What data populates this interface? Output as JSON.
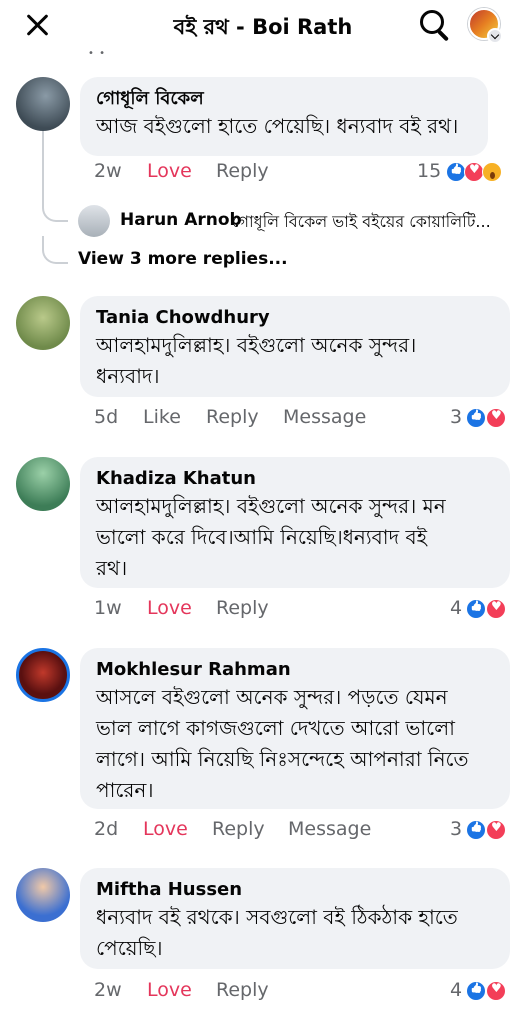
{
  "header": {
    "title": "বই রথ - Boi Rath",
    "close_icon": "close-icon",
    "search_icon": "search-icon",
    "more_dots": "• •"
  },
  "comments": [
    {
      "name": "গোধূলি বিকেল",
      "text_lines": [
        "আজ বইগুলো হাতে পেয়েছি। ধন্যবাদ বই রথ।"
      ],
      "time": "2w",
      "love": "Love",
      "reply": "Reply",
      "reaction_count": "15",
      "reactions": [
        "like",
        "love",
        "wow"
      ],
      "reply_preview": {
        "name": "Harun Arnob",
        "text": "গোধূলি বিকেল ভাই বইয়ের কোয়ালিটি..."
      },
      "more_replies": "View 3 more replies..."
    },
    {
      "name": "Tania Chowdhury",
      "text_lines": [
        "আলহামদুলিল্লাহ। বইগুলো অনেক সুন্দর।",
        "ধন্যবাদ।"
      ],
      "time": "5d",
      "like": "Like",
      "reply": "Reply",
      "message": "Message",
      "reaction_count": "3",
      "reactions": [
        "like",
        "love"
      ]
    },
    {
      "name": "Khadiza Khatun",
      "text_lines": [
        "আলহামদুলিল্লাহ। বইগুলো  অনেক সুন্দর। মন",
        "ভালো করে দিবে।আমি  নিয়েছি।ধন্যবাদ  বই",
        "রথ।"
      ],
      "time": "1w",
      "love": "Love",
      "reply": "Reply",
      "reaction_count": "4",
      "reactions": [
        "like",
        "love"
      ]
    },
    {
      "name": "Mokhlesur Rahman",
      "text_lines": [
        "আসলে বইগুলো অনেক সুন্দর। পড়তে যেমন",
        "ভাল লাগে কাগজগুলো দেখতে আরো ভালো",
        "লাগে। আমি নিয়েছি নিঃসন্দেহে আপনারা নিতে",
        "পারেন।"
      ],
      "time": "2d",
      "love": "Love",
      "reply": "Reply",
      "message": "Message",
      "reaction_count": "3",
      "reactions": [
        "like",
        "love"
      ]
    },
    {
      "name": "Miftha Hussen",
      "text_lines": [
        "ধন্যবাদ বই রথকে। সবগুলো বই ঠিকঠাক হাতে",
        "পেয়েছি।"
      ],
      "time": "2w",
      "love": "Love",
      "reply": "Reply",
      "reaction_count": "4",
      "reactions": [
        "like",
        "love"
      ]
    }
  ],
  "colors": {
    "love": "#e4365b",
    "like_blue": "#1b74e4",
    "bubble": "#f0f2f5",
    "meta": "#65676b"
  }
}
